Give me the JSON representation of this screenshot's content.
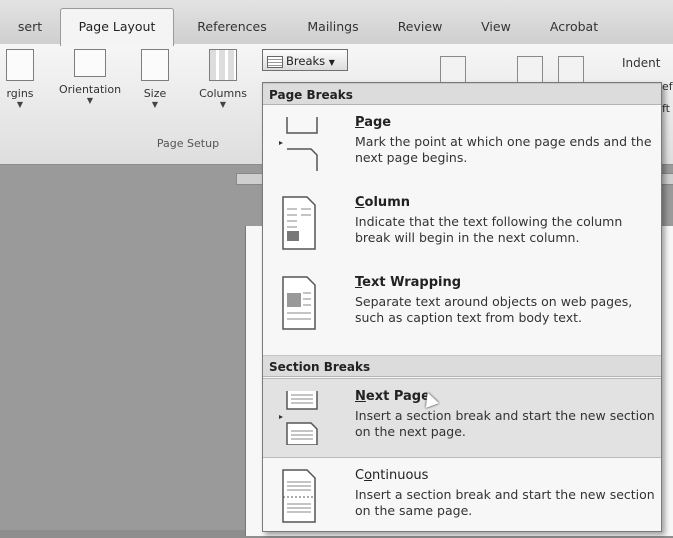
{
  "tabs": [
    {
      "label": "sert",
      "active": false
    },
    {
      "label": "Page Layout",
      "active": true
    },
    {
      "label": "References",
      "active": false
    },
    {
      "label": "Mailings",
      "active": false
    },
    {
      "label": "Review",
      "active": false
    },
    {
      "label": "View",
      "active": false
    },
    {
      "label": "Acrobat",
      "active": false
    }
  ],
  "ribbon": {
    "buttons": [
      "rgins",
      "Orientation",
      "Size",
      "Columns"
    ],
    "breaks_label": "Breaks",
    "group_label": "Page Setup",
    "indent_label": "Indent",
    "clip_right_1": "ef",
    "clip_right_2": "ft"
  },
  "breaks_menu": {
    "page_breaks_header": "Page Breaks",
    "section_breaks_header": "Section Breaks",
    "items": [
      {
        "title_pre": "",
        "title_u": "P",
        "title_post": "age",
        "desc": "Mark the point at which one page ends and the next page begins.",
        "icon": "page-break-icon"
      },
      {
        "title_pre": "",
        "title_u": "C",
        "title_post": "olumn",
        "desc": "Indicate that the text following the column break will begin in the next column.",
        "icon": "column-break-icon"
      },
      {
        "title_pre": "",
        "title_u": "T",
        "title_post": "ext Wrapping",
        "desc": "Separate text around objects on web pages, such as caption text from body text.",
        "icon": "text-wrapping-icon"
      },
      {
        "title_pre": "",
        "title_u": "N",
        "title_post": "ext Page",
        "desc": "Insert a section break and start the new section on the next page.",
        "icon": "next-page-section-icon"
      },
      {
        "title_pre": "C",
        "title_u": "o",
        "title_post": "ntinuous",
        "desc": "Insert a section break and start the new section on the same page.",
        "icon": "continuous-section-icon"
      }
    ]
  }
}
